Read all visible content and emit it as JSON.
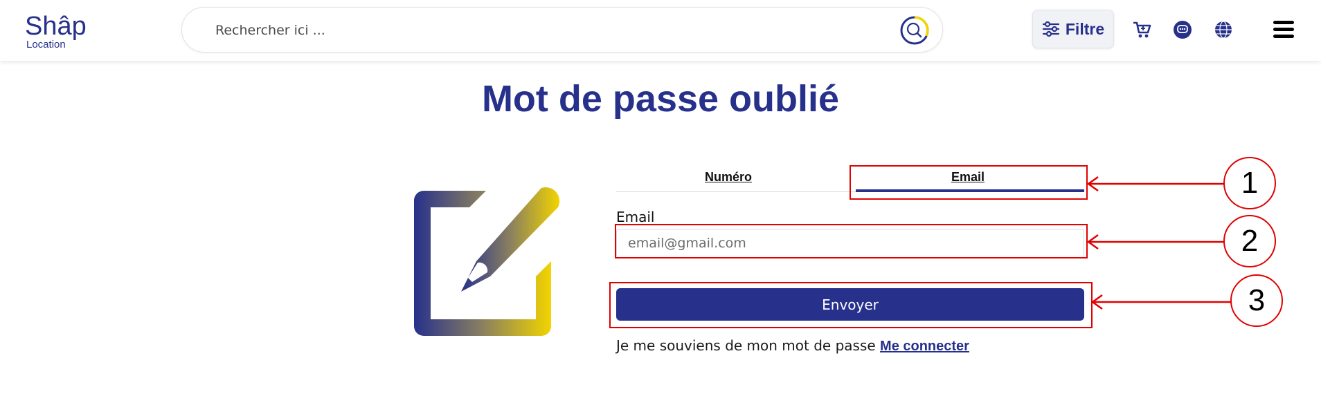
{
  "header": {
    "logo_text_top": "Shâp",
    "logo_text_bottom": "Location",
    "search_placeholder": "Rechercher ici ...",
    "filter_label": "Filtre",
    "icons": [
      "search-icon",
      "sliders-icon",
      "cart-icon",
      "chat-icon",
      "globe-icon",
      "menu-icon"
    ]
  },
  "page": {
    "title": "Mot de passe oublié"
  },
  "form": {
    "tabs": [
      {
        "label": "Numéro",
        "active": false
      },
      {
        "label": "Email",
        "active": true
      }
    ],
    "email_label": "Email",
    "email_placeholder": "email@gmail.com",
    "submit_label": "Envoyer",
    "remember_text": "Je me souviens de mon mot de passe",
    "login_link": "Me connecter"
  },
  "annotations": [
    "1",
    "2",
    "3"
  ],
  "colors": {
    "brand": "#27318b",
    "accent": "#f2d400",
    "annotation": "#e00000"
  }
}
